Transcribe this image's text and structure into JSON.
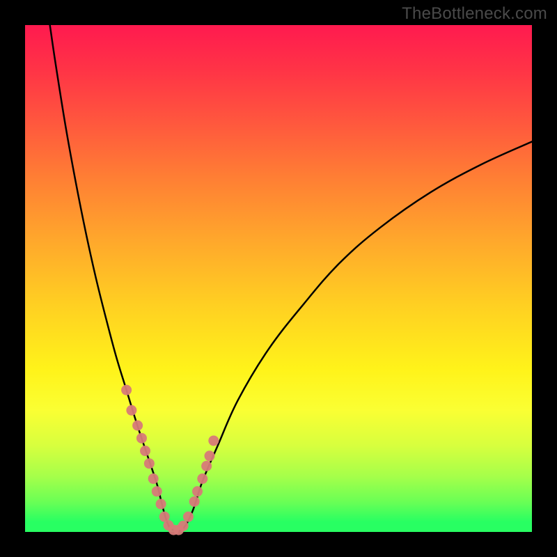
{
  "watermark": "TheBottleneck.com",
  "chart_data": {
    "type": "line",
    "title": "",
    "xlabel": "",
    "ylabel": "",
    "xlim": [
      0,
      100
    ],
    "ylim": [
      0,
      100
    ],
    "grid": false,
    "legend": false,
    "series": [
      {
        "name": "curve",
        "color": "#000000",
        "x": [
          4.9,
          6.0,
          8.0,
          10.0,
          12.0,
          14.0,
          16.0,
          18.0,
          20.0,
          22.0,
          24.0,
          26.0,
          27.0,
          28.0,
          29.0,
          31.0,
          33.0,
          35.0,
          38.0,
          42.0,
          48.0,
          55.0,
          62.0,
          70.0,
          80.0,
          90.0,
          100.0
        ],
        "y": [
          100.0,
          92.5,
          80.0,
          69.0,
          59.0,
          50.0,
          42.0,
          34.5,
          28.0,
          21.5,
          15.5,
          9.5,
          5.5,
          2.0,
          0.5,
          0.5,
          4.0,
          10.0,
          17.0,
          26.0,
          36.0,
          45.0,
          53.0,
          60.0,
          67.0,
          72.5,
          77.0
        ]
      }
    ],
    "points": {
      "name": "markers",
      "color": "#d77a78",
      "x": [
        20.0,
        21.0,
        22.2,
        23.0,
        23.7,
        24.5,
        25.3,
        26.0,
        26.8,
        27.5,
        28.3,
        29.3,
        30.3,
        31.2,
        32.2,
        33.4,
        34.0,
        35.0,
        35.8,
        36.4,
        37.2
      ],
      "y": [
        28.0,
        24.0,
        21.0,
        18.5,
        16.0,
        13.5,
        10.5,
        8.0,
        5.5,
        3.0,
        1.3,
        0.4,
        0.4,
        1.2,
        3.0,
        6.0,
        8.0,
        10.5,
        13.0,
        15.0,
        18.0
      ]
    },
    "colors": {
      "gradient_top": "#ff1a4f",
      "gradient_mid": "#ffd21f",
      "gradient_bottom": "#28ff62",
      "frame": "#000000",
      "marker": "#d77a78"
    }
  }
}
